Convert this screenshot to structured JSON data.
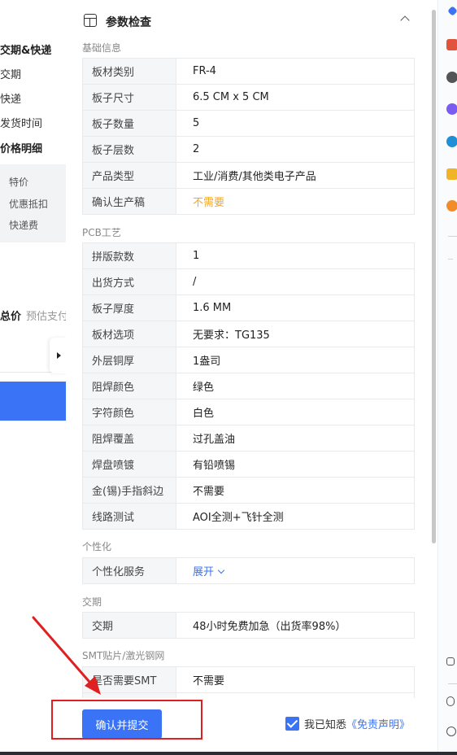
{
  "background": {
    "delivery_heading": "交期&快递",
    "delivery": "交期",
    "express": "快递",
    "ship_time": "发货时间",
    "price_detail": "价格明细",
    "special_price": "特价",
    "discount": "优惠抵扣",
    "shipping_fee": "快递费",
    "total_label": "总价",
    "total_note": "预估支付"
  },
  "panel": {
    "title": "参数检查",
    "sections": {
      "basic": "基础信息",
      "pcb": "PCB工艺",
      "custom": "个性化",
      "leadtime": "交期",
      "smt": "SMT贴片/激光钢网"
    },
    "basic_rows": [
      {
        "k": "板材类别",
        "v": "FR-4"
      },
      {
        "k": "板子尺寸",
        "v": "6.5 CM x  5 CM"
      },
      {
        "k": "板子数量",
        "v": "5"
      },
      {
        "k": "板子层数",
        "v": "2"
      },
      {
        "k": "产品类型",
        "v": "工业/消费/其他类电子产品"
      },
      {
        "k": "确认生产稿",
        "v": "不需要"
      }
    ],
    "pcb_rows": [
      {
        "k": "拼版款数",
        "v": "1"
      },
      {
        "k": "出货方式",
        "v": "/"
      },
      {
        "k": "板子厚度",
        "v": "1.6 MM"
      },
      {
        "k": "板材选项",
        "v": "无要求：TG135"
      },
      {
        "k": "外层铜厚",
        "v": "1盎司"
      },
      {
        "k": "阻焊颜色",
        "v": "绿色"
      },
      {
        "k": "字符颜色",
        "v": "白色"
      },
      {
        "k": "阻焊覆盖",
        "v": "过孔盖油"
      },
      {
        "k": "焊盘喷镀",
        "v": "有铅喷锡"
      },
      {
        "k": "金(锡)手指斜边",
        "v": "不需要"
      },
      {
        "k": "线路测试",
        "v": "AOI全测+飞针全测"
      }
    ],
    "custom_row": {
      "k": "个性化服务",
      "v": "展开"
    },
    "leadtime_row": {
      "k": "交期",
      "v": "48小时免费加急（出货率98%）"
    },
    "smt_row": {
      "k": "是否需要SMT",
      "v": "不需要"
    }
  },
  "footer": {
    "submit": "确认并提交",
    "agree_text": "我已知悉",
    "disclaimer": "《免责声明》"
  },
  "colors": {
    "accent": "#3b73f6",
    "warning": "#f5a623",
    "annotation": "#e02020"
  }
}
